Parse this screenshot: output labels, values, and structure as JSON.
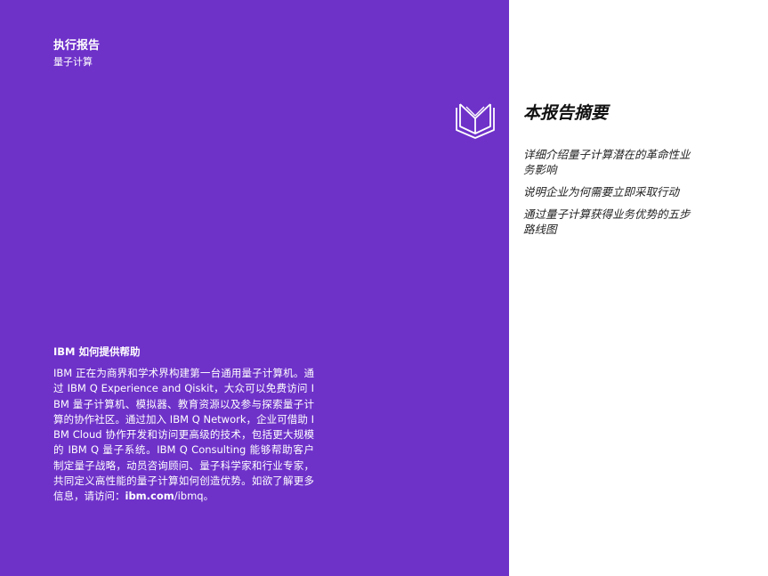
{
  "header": {
    "title": "执行报告",
    "subtitle": "量子计算"
  },
  "help": {
    "title": "IBM 如何提供帮助",
    "body": "IBM 正在为商界和学术界构建第一台通用量子计算机。通过 IBM Q Experience and Qiskit，大众可以免费访问 IBM 量子计算机、模拟器、教育资源以及参与探索量子计算的协作社区。通过加入 IBM Q Network，企业可借助 IBM Cloud 协作开发和访问更高级的技术，包括更大规模的 IBM Q 量子系统。IBM Q Consulting 能够帮助客户制定量子战略，动员咨询顾问、量子科学家和行业专家，共同定义高性能的量子计算如何创造优势。如欲了解更多信息，请访问：",
    "link": "ibm.com",
    "link_suffix": "/ibmq。"
  },
  "summary": {
    "icon": "open-book-icon",
    "title": "本报告摘要",
    "items": [
      "详细介绍量子计算潜在的革命性业务影响",
      "说明企业为何需要立即采取行动",
      "通过量子计算获得业务优势的五步路线图"
    ]
  },
  "colors": {
    "panel": "#6e32c9",
    "text_on_panel": "#ffffff",
    "text_dark": "#111111"
  }
}
